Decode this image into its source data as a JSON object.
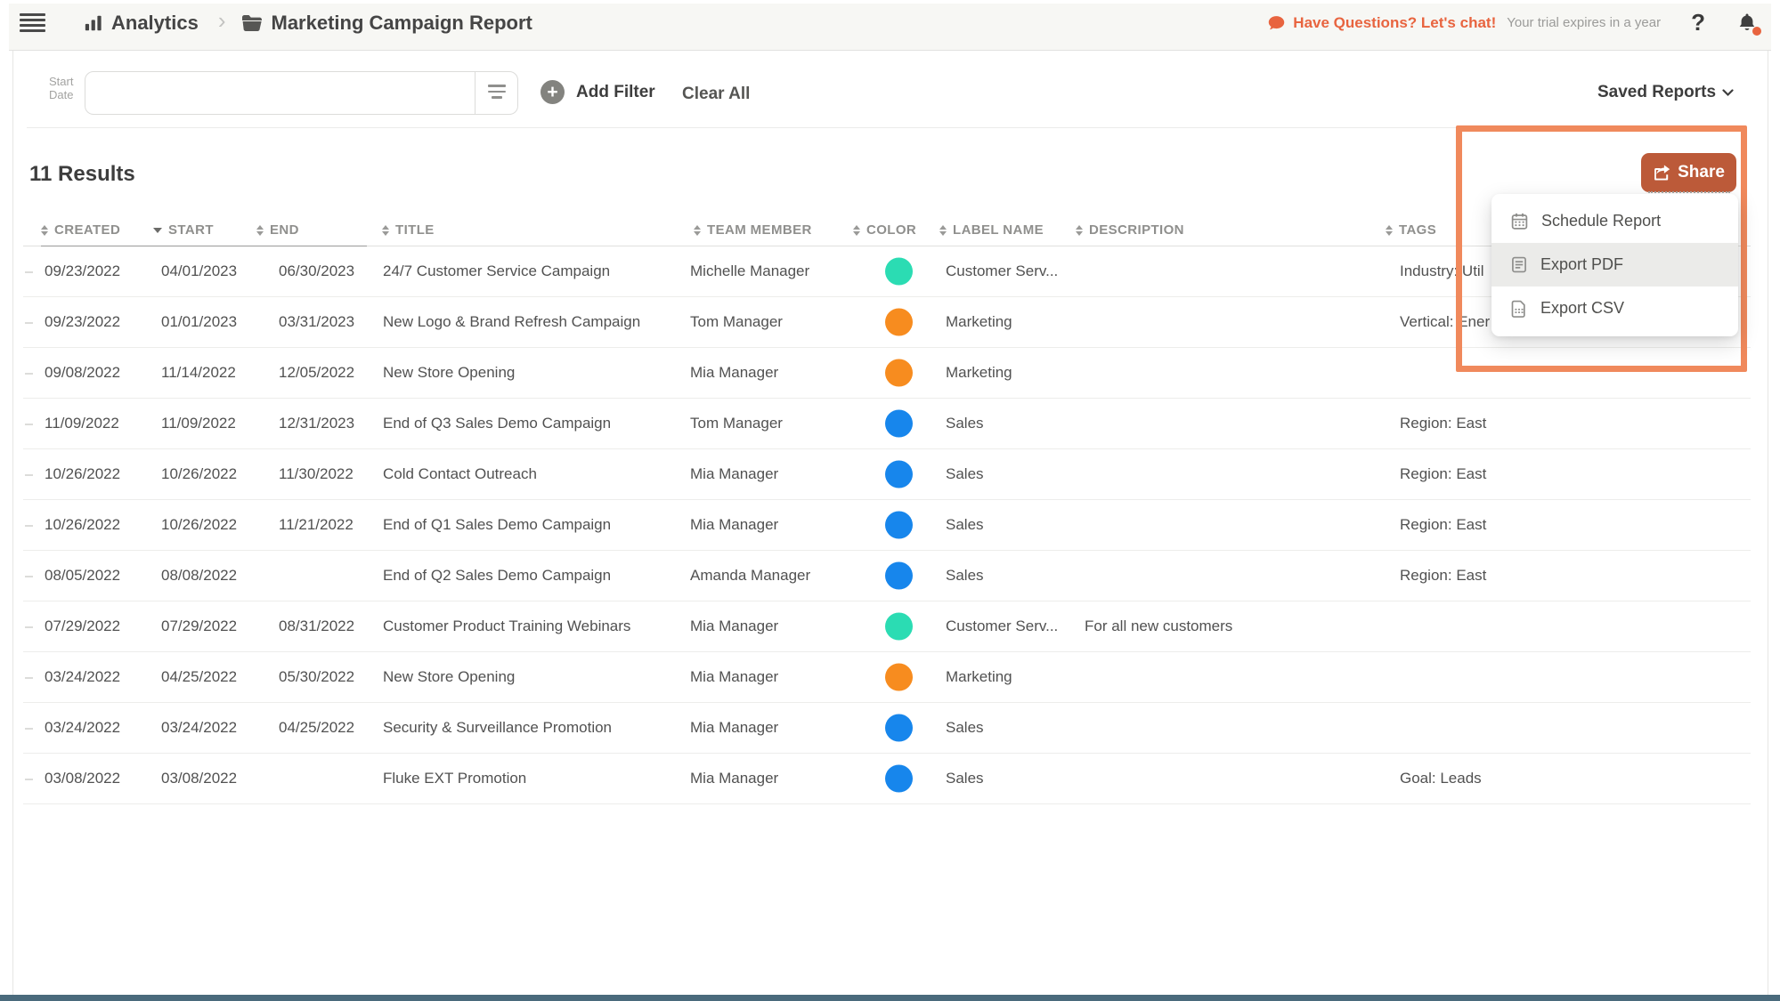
{
  "topbar": {
    "brand": "Analytics",
    "title": "Marketing Campaign Report",
    "chat": "Have Questions? Let's chat!",
    "trial": "Your trial expires in a year",
    "help": "?"
  },
  "filters": {
    "field_label_line1": "Start",
    "field_label_line2": "Date",
    "input_value": "",
    "add_filter": "Add Filter",
    "clear_all": "Clear All",
    "saved_reports": "Saved Reports"
  },
  "results": {
    "count_label": "11 Results"
  },
  "table": {
    "columns": [
      {
        "key": "created",
        "label": "CREATED",
        "sort": "both"
      },
      {
        "key": "start",
        "label": "START",
        "sort": "desc"
      },
      {
        "key": "end",
        "label": "END",
        "sort": "both"
      },
      {
        "key": "title",
        "label": "TITLE",
        "sort": "both"
      },
      {
        "key": "team",
        "label": "TEAM MEMBER",
        "sort": "both"
      },
      {
        "key": "color",
        "label": "COLOR",
        "sort": "both"
      },
      {
        "key": "label",
        "label": "LABEL NAME",
        "sort": "both"
      },
      {
        "key": "description",
        "label": "DESCRIPTION",
        "sort": "both"
      },
      {
        "key": "tags",
        "label": "TAGS",
        "sort": "both"
      }
    ],
    "rows": [
      {
        "created": "09/23/2022",
        "start": "04/01/2023",
        "end": "06/30/2023",
        "title": "24/7 Customer Service Campaign",
        "team": "Michelle Manager",
        "color": "#2bdcb3",
        "label": "Customer Serv...",
        "description": "",
        "tags": "Industry: Util"
      },
      {
        "created": "09/23/2022",
        "start": "01/01/2023",
        "end": "03/31/2023",
        "title": "New Logo & Brand Refresh Campaign",
        "team": "Tom Manager",
        "color": "#f78c1f",
        "label": "Marketing",
        "description": "",
        "tags": "Vertical: Ener"
      },
      {
        "created": "09/08/2022",
        "start": "11/14/2022",
        "end": "12/05/2022",
        "title": "New Store Opening",
        "team": "Mia Manager",
        "color": "#f78c1f",
        "label": "Marketing",
        "description": "",
        "tags": ""
      },
      {
        "created": "11/09/2022",
        "start": "11/09/2022",
        "end": "12/31/2023",
        "title": "End of Q3 Sales Demo Campaign",
        "team": "Tom Manager",
        "color": "#1786ec",
        "label": "Sales",
        "description": "",
        "tags": "Region: East"
      },
      {
        "created": "10/26/2022",
        "start": "10/26/2022",
        "end": "11/30/2022",
        "title": "Cold Contact Outreach",
        "team": "Mia Manager",
        "color": "#1786ec",
        "label": "Sales",
        "description": "",
        "tags": "Region: East"
      },
      {
        "created": "10/26/2022",
        "start": "10/26/2022",
        "end": "11/21/2022",
        "title": "End of Q1 Sales Demo Campaign",
        "team": "Mia Manager",
        "color": "#1786ec",
        "label": "Sales",
        "description": "",
        "tags": "Region: East"
      },
      {
        "created": "08/05/2022",
        "start": "08/08/2022",
        "end": "",
        "title": "End of Q2 Sales Demo Campaign",
        "team": "Amanda Manager",
        "color": "#1786ec",
        "label": "Sales",
        "description": "",
        "tags": "Region: East"
      },
      {
        "created": "07/29/2022",
        "start": "07/29/2022",
        "end": "08/31/2022",
        "title": "Customer Product Training Webinars",
        "team": "Mia Manager",
        "color": "#2bdcb3",
        "label": "Customer Serv...",
        "description": "For all new customers",
        "tags": ""
      },
      {
        "created": "03/24/2022",
        "start": "04/25/2022",
        "end": "05/30/2022",
        "title": "New Store Opening",
        "team": "Mia Manager",
        "color": "#f78c1f",
        "label": "Marketing",
        "description": "",
        "tags": ""
      },
      {
        "created": "03/24/2022",
        "start": "03/24/2022",
        "end": "04/25/2022",
        "title": "Security & Surveillance Promotion",
        "team": "Mia Manager",
        "color": "#1786ec",
        "label": "Sales",
        "description": "",
        "tags": ""
      },
      {
        "created": "03/08/2022",
        "start": "03/08/2022",
        "end": "",
        "title": "Fluke EXT Promotion",
        "team": "Mia Manager",
        "color": "#1786ec",
        "label": "Sales",
        "description": "",
        "tags": "Goal: Leads"
      }
    ]
  },
  "share": {
    "button": "Share",
    "menu": [
      {
        "label": "Schedule Report",
        "icon": "calendar-icon",
        "highlight": false
      },
      {
        "label": "Export PDF",
        "icon": "export-pdf-icon",
        "highlight": true
      },
      {
        "label": "Export CSV",
        "icon": "export-csv-icon",
        "highlight": false
      }
    ]
  },
  "colors": {
    "accent_orange": "#e8643f",
    "share_button": "#bc5a39",
    "highlight_border": "#f0895c",
    "label_teal": "#2bdcb3",
    "label_orange": "#f78c1f",
    "label_blue": "#1786ec",
    "bottom_bar": "#4a6a7c"
  }
}
